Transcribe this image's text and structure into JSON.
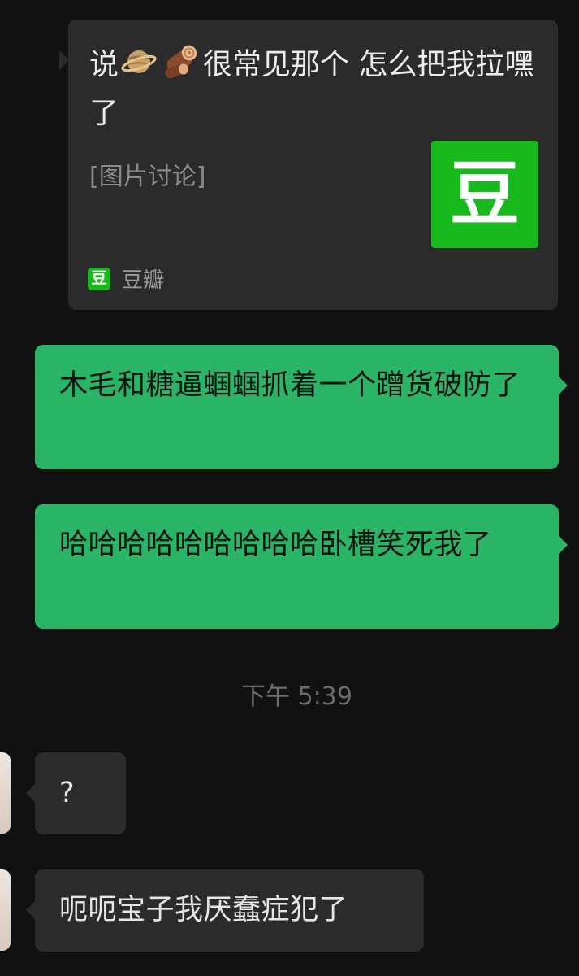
{
  "link_card": {
    "title_prefix": "说",
    "title_suffix": "很常见那个 怎么把我拉嘿了",
    "emojis": [
      "saturn-planet-icon",
      "wood-log-icon"
    ],
    "subtitle": "[图片讨论]",
    "thumbnail_char": "豆",
    "source_icon_char": "豆",
    "source_name": "豆瓣"
  },
  "messages": [
    {
      "id": "msg-1",
      "direction": "sent",
      "text": "木毛和糖逼蝈蝈抓着一个蹭货破防了"
    },
    {
      "id": "msg-2",
      "direction": "sent",
      "text": "哈哈哈哈哈哈哈哈哈卧槽笑死我了"
    }
  ],
  "timestamp": "下午 5:39",
  "received": [
    {
      "id": "msg-3",
      "direction": "received",
      "text": "?"
    },
    {
      "id": "msg-4",
      "direction": "received",
      "text": "呃呃宝子我厌蠢症犯了"
    }
  ],
  "colors": {
    "background": "#111111",
    "sent_bubble": "#2ab566",
    "received_bubble": "#2b2b2b",
    "douban_green": "#17b91c",
    "timestamp_text": "#6b6b6b"
  }
}
